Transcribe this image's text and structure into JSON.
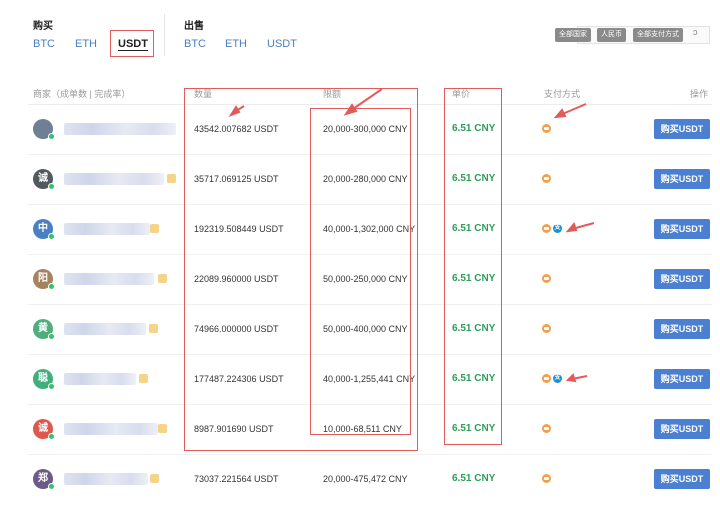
{
  "buy_section": {
    "title": "购买",
    "tabs": [
      "BTC",
      "ETH",
      "USDT"
    ]
  },
  "sell_section": {
    "title": "出售",
    "tabs": [
      "BTC",
      "ETH",
      "USDT"
    ]
  },
  "filters": {
    "country": "全部国家",
    "currency": "人民币",
    "payment": "全部支付方式"
  },
  "columns": {
    "merchant": "商家（成单数 | 完成率）",
    "quantity": "数量",
    "limit": "限额",
    "price": "单价",
    "payment": "支付方式",
    "action": "操作"
  },
  "rows": [
    {
      "avatar": "",
      "avatar_color": "#6f7f95",
      "quantity": "43542.007682 USDT",
      "limit": "20,000-300,000 CNY",
      "price": "6.51 CNY",
      "payment_icons": [
        "bank-card-icon"
      ],
      "button": "购买USDT"
    },
    {
      "avatar": "诚",
      "avatar_color": "#515a5f",
      "quantity": "35717.069125 USDT",
      "limit": "20,000-280,000 CNY",
      "price": "6.51 CNY",
      "payment_icons": [
        "bank-card-icon"
      ],
      "button": "购买USDT"
    },
    {
      "avatar": "中",
      "avatar_color": "#4a7fc1",
      "quantity": "192319.508449 USDT",
      "limit": "40,000-1,302,000 CNY",
      "price": "6.51 CNY",
      "payment_icons": [
        "bank-card-icon",
        "alipay-icon"
      ],
      "button": "购买USDT"
    },
    {
      "avatar": "阳",
      "avatar_color": "#a4845f",
      "quantity": "22089.960000 USDT",
      "limit": "50,000-250,000 CNY",
      "price": "6.51 CNY",
      "payment_icons": [
        "bank-card-icon"
      ],
      "button": "购买USDT"
    },
    {
      "avatar": "黄",
      "avatar_color": "#4fae7b",
      "quantity": "74966.000000 USDT",
      "limit": "50,000-400,000 CNY",
      "price": "6.51 CNY",
      "payment_icons": [
        "bank-card-icon"
      ],
      "button": "购买USDT"
    },
    {
      "avatar": "聪",
      "avatar_color": "#3fb07b",
      "quantity": "177487.224306 USDT",
      "limit": "40,000-1,255,441 CNY",
      "price": "6.51 CNY",
      "payment_icons": [
        "bank-card-icon",
        "alipay-icon"
      ],
      "button": "购买USDT"
    },
    {
      "avatar": "诚",
      "avatar_color": "#e0574e",
      "quantity": "8987.901690 USDT",
      "limit": "10,000-68,511 CNY",
      "price": "6.51 CNY",
      "payment_icons": [
        "bank-card-icon"
      ],
      "button": "购买USDT"
    },
    {
      "avatar": "郑",
      "avatar_color": "#6d5a87",
      "quantity": "73037.221564 USDT",
      "limit": "20,000-475,472 CNY",
      "price": "6.51 CNY",
      "payment_icons": [
        "bank-card-icon"
      ],
      "button": "购买USDT"
    }
  ],
  "colors": {
    "accent": "#4b7fd1",
    "price": "#2f9c59",
    "annotation": "#e25b5b",
    "online": "#35c26b"
  }
}
